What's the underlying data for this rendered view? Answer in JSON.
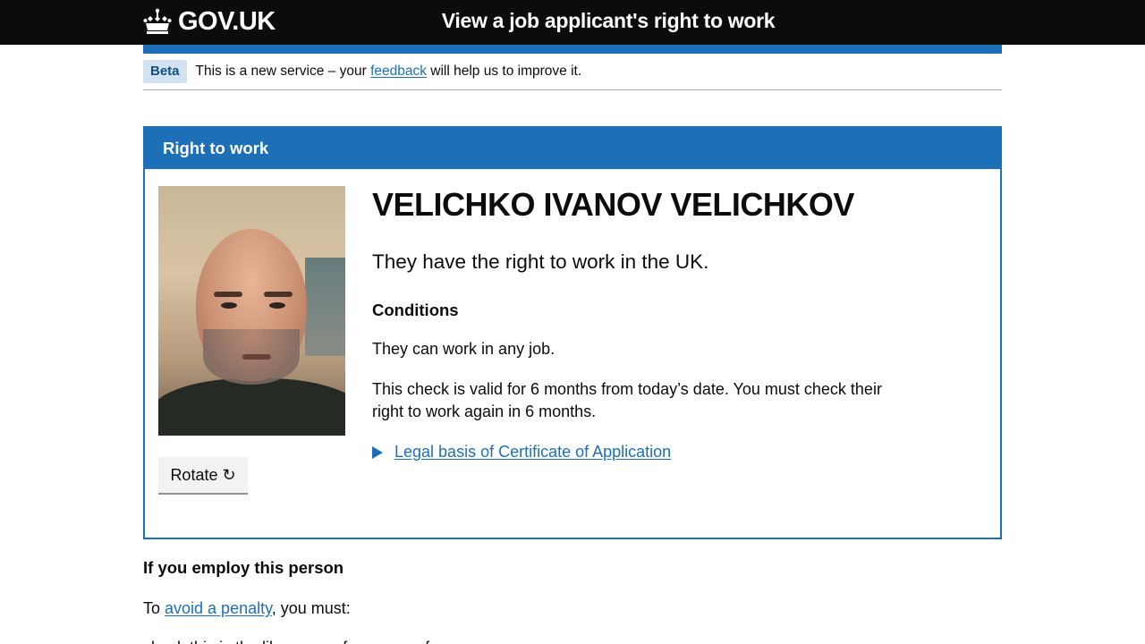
{
  "header": {
    "logo_text": "GOV.UK",
    "service_name": "View a job applicant's right to work"
  },
  "phase_banner": {
    "tag": "Beta",
    "text_before": "This is a new service – your ",
    "link": "feedback",
    "text_after": " will help us to improve it."
  },
  "panel": {
    "title": "Right to work",
    "rotate_label": "Rotate ↻",
    "name": "VELICHKO IVANOV VELICHKOV",
    "status": "They have the right to work in the UK.",
    "conditions_heading": "Conditions",
    "condition_text": "They can work in any job.",
    "validity_text": "This check is valid for 6 months from today’s date. You must check their right to work again in 6 months.",
    "details_summary": "Legal basis of Certificate of Application"
  },
  "below": {
    "heading": "If you employ this person",
    "para_before": "To ",
    "para_link": "avoid a penalty",
    "para_after": ", you must:",
    "cut_text": "check this is the likeness ... for a... proof ..."
  },
  "colors": {
    "header_bg": "#0b0c0c",
    "brand_blue": "#1d70b8",
    "tag_bg": "#d2e2f1",
    "button_bg": "#f3f2f1"
  }
}
